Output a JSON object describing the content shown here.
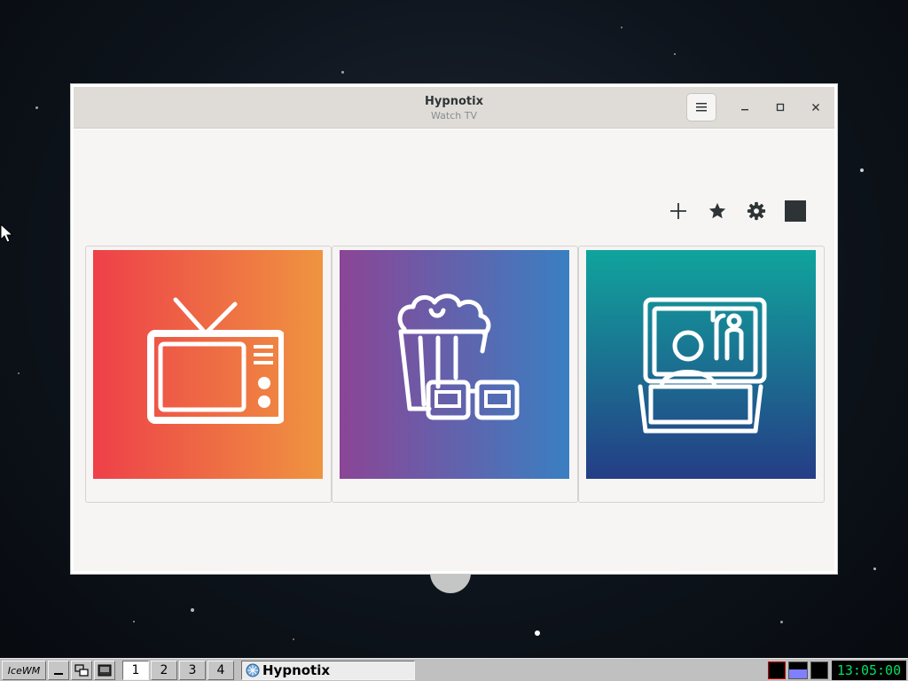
{
  "window": {
    "title": "Hypnotix",
    "subtitle": "Watch TV",
    "menu_icon": "hamburger-menu-icon",
    "minimize_icon": "minimize-icon",
    "maximize_icon": "maximize-icon",
    "close_icon": "close-icon"
  },
  "toolbar": {
    "icons": [
      "add-icon",
      "star-icon",
      "gear-icon",
      "fullscreen-square-icon"
    ]
  },
  "cards": [
    {
      "icon": "tv-icon",
      "gradient": [
        "#ee4049",
        "#ef9440"
      ]
    },
    {
      "icon": "movies-popcorn-icon",
      "gradient": [
        "#8b4596",
        "#3a7fc2"
      ]
    },
    {
      "icon": "series-theater-icon",
      "gradient": [
        "#10a49c",
        "#253d86"
      ]
    }
  ],
  "taskbar": {
    "start_label": "IceWM",
    "workspaces": [
      "1",
      "2",
      "3",
      "4"
    ],
    "active_workspace": "1",
    "task_label": "Hypnotix",
    "clock": "13:05:00"
  }
}
